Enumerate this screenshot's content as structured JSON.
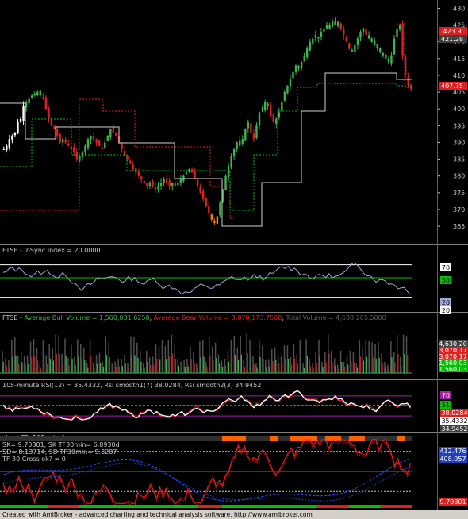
{
  "colors": {
    "background": "#000000",
    "axis_panel": "#000000",
    "separator": "#808080",
    "up": "#3cb44b",
    "down": "#e02020",
    "white": "#ffffff",
    "green_line": "#00c000",
    "red_line": "#ff2020",
    "blue_line": "#4060ff",
    "magenta": "#a020a0",
    "orange": "#ff8000",
    "purple_box": "#8000a0"
  },
  "chart_data": [
    {
      "type": "candlestick",
      "panel": "price",
      "ylim": [
        361,
        432
      ],
      "y_ticks": [
        "430",
        "425",
        "420",
        "415",
        "410",
        "405",
        "400",
        "395",
        "390",
        "385",
        "380",
        "375",
        "370",
        "365"
      ],
      "value_boxes": [
        "423.9",
        "421.28",
        "407.75"
      ],
      "close_series": [
        388,
        389,
        391,
        392,
        393,
        396,
        397,
        401,
        402,
        403,
        404,
        404,
        405,
        404,
        403,
        400,
        397,
        395,
        394,
        392,
        390,
        391,
        390,
        389,
        388,
        387,
        385,
        386,
        387,
        389,
        391,
        392,
        391,
        390,
        389,
        388,
        390,
        392,
        394,
        393,
        392,
        390,
        388,
        386,
        385,
        384,
        382,
        381,
        380,
        379,
        378,
        377,
        378,
        377,
        376,
        377,
        378,
        379,
        378,
        377,
        378,
        377,
        378,
        379,
        380,
        381,
        382,
        381,
        379,
        377,
        375,
        373,
        371,
        369,
        367,
        366,
        368,
        372,
        376,
        380,
        383,
        386,
        388,
        390,
        389,
        391,
        394,
        396,
        393,
        391,
        395,
        399,
        400,
        402,
        401,
        398,
        396,
        397,
        399,
        402,
        405,
        407,
        409,
        411,
        413,
        412,
        414,
        416,
        418,
        420,
        421,
        422,
        421,
        423,
        424,
        425,
        424,
        426,
        425,
        426,
        424,
        422,
        420,
        418,
        417,
        419,
        421,
        423,
        424,
        422,
        421,
        420,
        419,
        418,
        417,
        416,
        415,
        414,
        416,
        421,
        424,
        425,
        416,
        410,
        407,
        406
      ]
    },
    {
      "type": "line",
      "panel": "insync",
      "title": "FTSE - InSync Index = 20.0000",
      "y_ticks": [
        "70",
        "50",
        "20"
      ],
      "value_boxes": [
        "70",
        "50",
        "20",
        "20"
      ]
    },
    {
      "type": "bar",
      "panel": "volume",
      "title_parts": [
        {
          "text": "FTSE - ",
          "color": "#c8c8c8"
        },
        {
          "text": "Average Bull Volume = 1,560,031.6250",
          "color": "#3cb44b"
        },
        {
          "text": ", ",
          "color": "#c8c8c8"
        },
        {
          "text": "Average Bear Volume = 3,070,173.7500",
          "color": "#e02020"
        },
        {
          "text": ", ",
          "color": "#c8c8c8"
        },
        {
          "text": "Total Volume = 4,630,205.5000",
          "color": "#606060"
        }
      ],
      "value_boxes": [
        "4,630,20",
        "3,070,17",
        "3,070,17",
        "1,560,03",
        "1,560,03"
      ]
    },
    {
      "type": "line",
      "panel": "rsi",
      "title": "105-minute RSI(12) = 35.4332, Rsi smooth1(7) 38.0284, Rsi smooth2(3) 34.9452",
      "value_boxes": [
        "70",
        "51",
        "38.0284",
        "35.4332",
        "34.9452"
      ]
    },
    {
      "type": "line",
      "panel": "stochastic",
      "title_lines": [
        "chart TF :105-minute",
        "SK= 9.70801,  SK TF30min= 6.8930d",
        "SD= 8.13714,  SD TF30min= 9.8287",
        "TF 30 Cross ok? = 0"
      ],
      "value_boxes": [
        "412.476",
        "408.957",
        "9.70801"
      ]
    }
  ],
  "footer": {
    "text": "Created with AmiBroker - advanced charting and technical analysis software. http://www.amibroker.com"
  }
}
